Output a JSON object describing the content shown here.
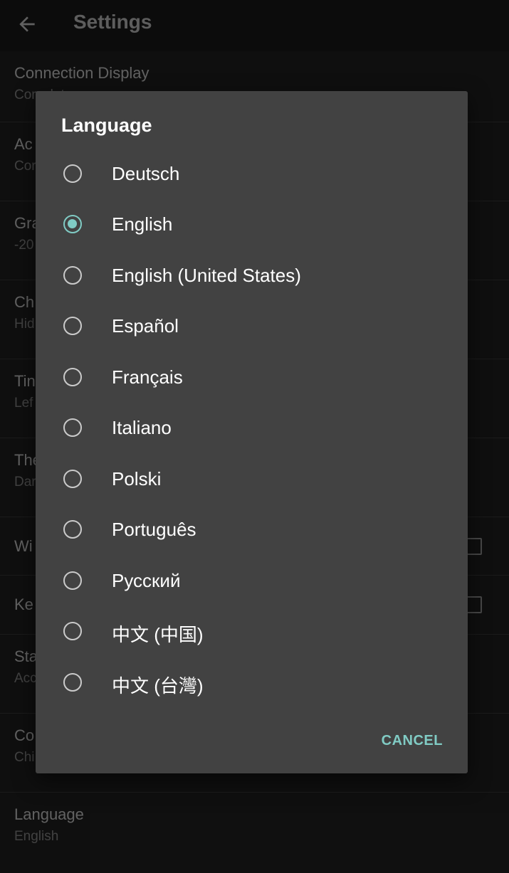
{
  "appbar": {
    "title": "Settings"
  },
  "settings": [
    {
      "title": "Connection Display",
      "subtitle": "Complete"
    },
    {
      "title": "Ac",
      "subtitle": "Cor"
    },
    {
      "title": "Gra",
      "subtitle": "-20"
    },
    {
      "title": "Ch",
      "subtitle": "Hid"
    },
    {
      "title": "Tin",
      "subtitle": "Lef"
    },
    {
      "title": "The",
      "subtitle": "Dar"
    },
    {
      "title": "Wi"
    },
    {
      "title": "Ke"
    },
    {
      "title": "Sta",
      "subtitle": "Acc"
    },
    {
      "title": "Co",
      "subtitle": "Chi"
    },
    {
      "title": "Language",
      "subtitle": "English"
    }
  ],
  "dialog": {
    "title": "Language",
    "selected": "English",
    "options": [
      "Deutsch",
      "English",
      "English (United States)",
      "Español",
      "Français",
      "Italiano",
      "Polski",
      "Português",
      "Русский",
      "中文 (中国)",
      "中文 (台灣)"
    ],
    "cancel_label": "CANCEL"
  },
  "colors": {
    "accent": "#80cbc4",
    "dialog_background": "#424242",
    "page_background": "#1b1b1b"
  }
}
